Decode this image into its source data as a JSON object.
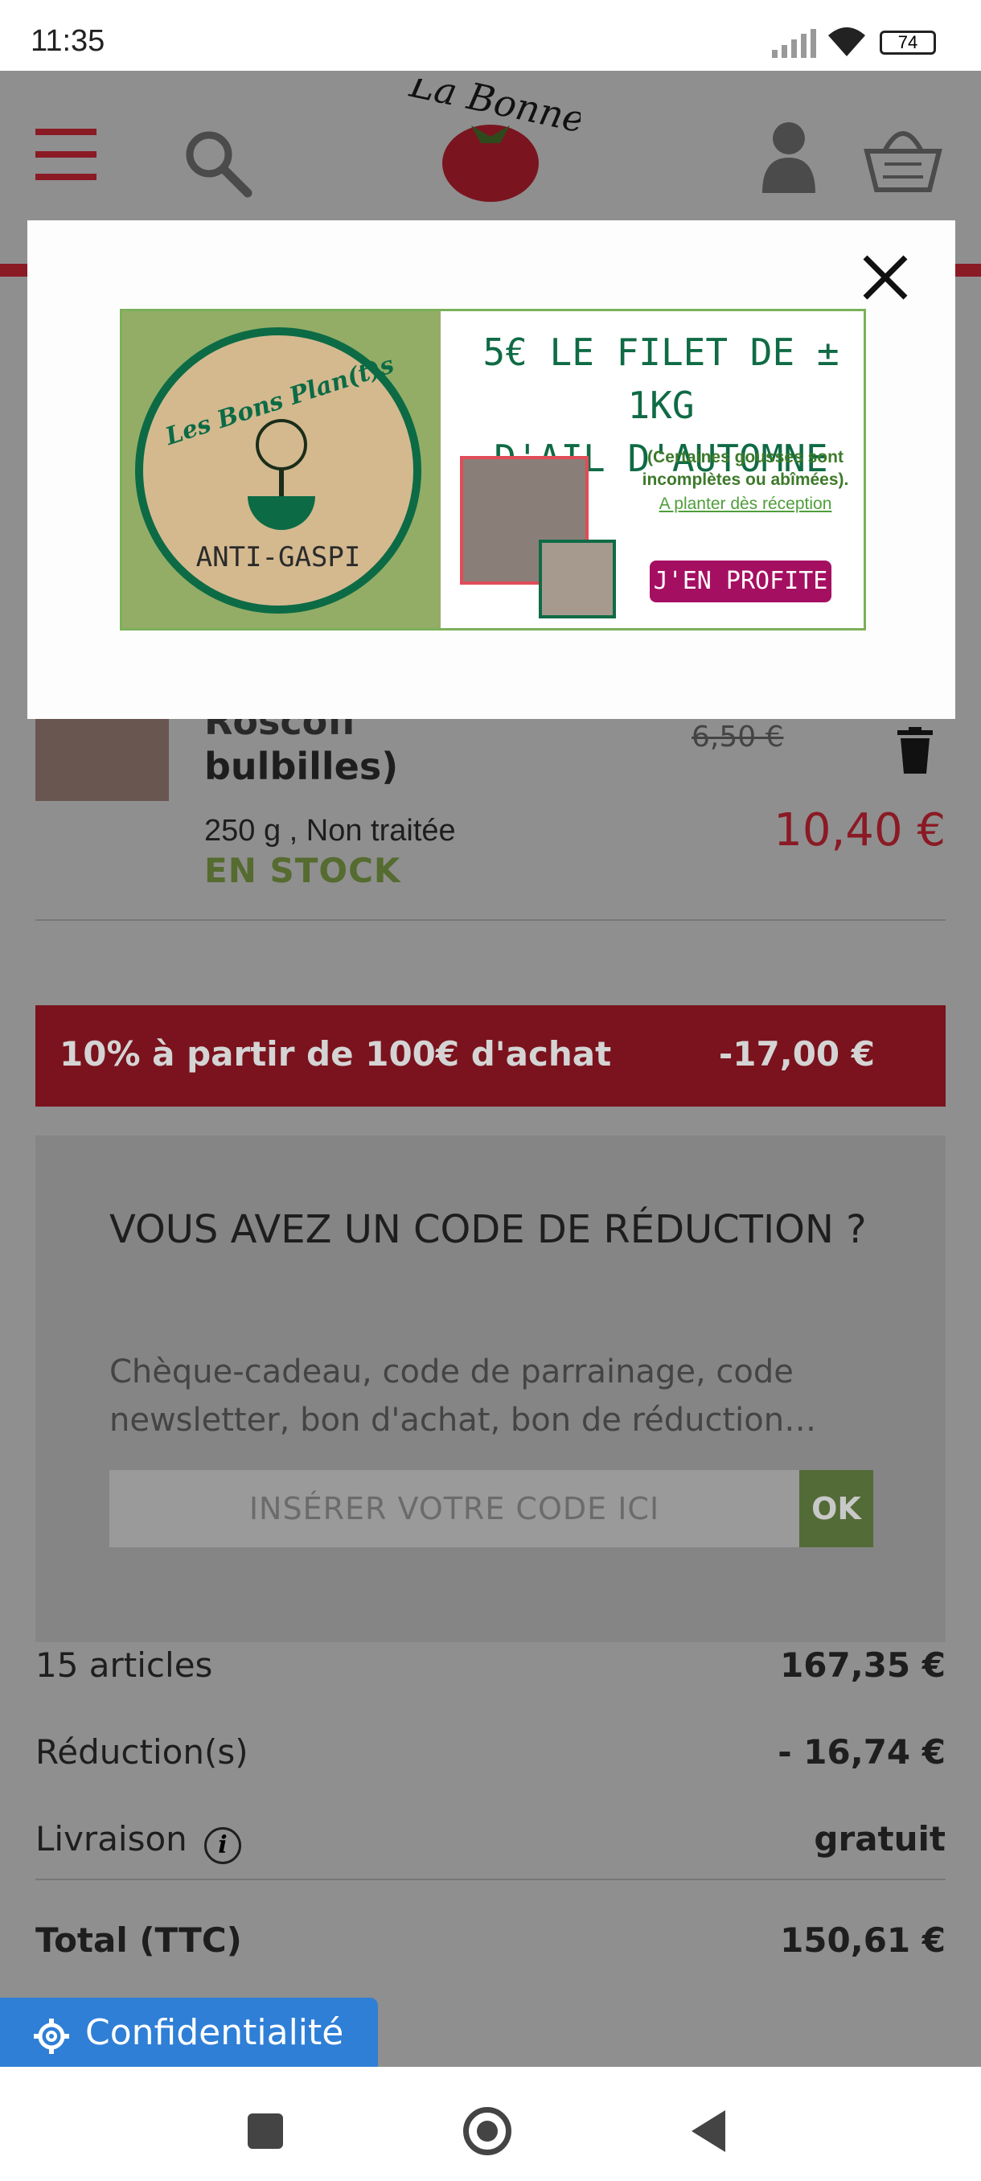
{
  "status_bar": {
    "time": "11:35",
    "battery": "74"
  },
  "header": {
    "logo_text": "La Bonne Graine",
    "menu_icon": "hamburger-icon",
    "search_icon": "search-icon",
    "account_icon": "user-icon",
    "cart_icon": "basket-icon"
  },
  "popup": {
    "close_icon": "close-icon",
    "banner": {
      "badge_top": "Les Bons Plan(t)s",
      "badge_bottom": "ANTI-GASPI",
      "headline_1": "5€ LE FILET DE ± 1KG",
      "headline_2": "D'AIL D'AUTOMNE",
      "note": "(Certaines gousses sont incomplètes ou abîmées).",
      "note_link": "A planter dès réception",
      "button": "J'EN PROFITE"
    }
  },
  "cart_item": {
    "name_partial": "bulbilles)",
    "details": "250 g , Non traitée",
    "stock": "EN STOCK",
    "old_price": "6,50 €",
    "price": "10,40 €",
    "delete_icon": "trash-icon"
  },
  "promo": {
    "label": "10% à partir de 100€ d'achat",
    "amount": "-17,00 €"
  },
  "discount_code": {
    "title": "VOUS AVEZ UN CODE DE RÉDUCTION ?",
    "description": "Chèque-cadeau, code de parrainage, code newsletter, bon d'achat, bon de réduction…",
    "placeholder": "INSÉRER VOTRE CODE ICI",
    "ok": "OK"
  },
  "summary": {
    "articles_label": "15 articles",
    "articles_value": "167,35 €",
    "reduction_label": "Réduction(s)",
    "reduction_value": "- 16,74 €",
    "delivery_label": "Livraison",
    "delivery_value": "gratuit",
    "total_label": "Total (TTC)",
    "total_value": "150,61 €"
  },
  "privacy_button": "Confidentialité",
  "colors": {
    "brand_red": "#8a1a24",
    "stock_green": "#556b2f",
    "popup_green": "#0f6b45",
    "cta_magenta": "#a50f62",
    "privacy_blue": "#2f7fd6"
  }
}
